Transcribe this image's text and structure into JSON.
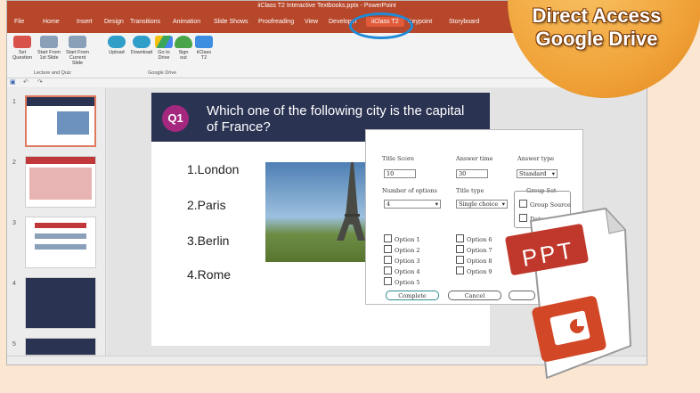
{
  "window": {
    "title": "iiClass T2 Interactive Textbooks.pptx - PowerPoint"
  },
  "tabs": [
    "File",
    "Home",
    "Insert",
    "Design",
    "Transitions",
    "Animation",
    "Slide Shows",
    "Proofreading",
    "View",
    "Developer",
    "iiClass T2",
    "Keypoint",
    "Storyboard"
  ],
  "ribbon": {
    "buttons": [
      {
        "label": "Set\nQuestion",
        "color": "#d8524b",
        "icon": "gear-icon"
      },
      {
        "label": "Start From\n1st Slide",
        "color": "#8aa0b9",
        "icon": "slide-icon"
      },
      {
        "label": "Start From\nCurrent Slide",
        "color": "#8aa0b9",
        "icon": "slide-icon"
      },
      {
        "label": "Upload",
        "color": "#2f9ec9",
        "icon": "cloud-upload-icon"
      },
      {
        "label": "Download",
        "color": "#2f9ec9",
        "icon": "cloud-download-icon"
      },
      {
        "label": "Go to\nDrive",
        "color": "#3ba55c",
        "icon": "drive-icon"
      },
      {
        "label": "Sign\nout",
        "color": "#4aa54a",
        "icon": "person-icon"
      },
      {
        "label": "iiClass\nT2",
        "color": "#3d8ee0",
        "icon": "iiclass-icon"
      }
    ],
    "group_lecture": "Lecture and Quiz",
    "group_drive": "Google Drive"
  },
  "thumbnails": [
    "1",
    "2",
    "3",
    "4",
    "5"
  ],
  "slide": {
    "badge": "Q1",
    "question": "Which one of the following city is the capital of France?",
    "options": [
      "1.London",
      "2.Paris",
      "3.Berlin",
      "4.Rome"
    ]
  },
  "dialog": {
    "title_score_label": "Title Score",
    "answer_time_label": "Answer time",
    "answer_type_label": "Answer type",
    "title_score_value": "10",
    "answer_time_value": "30",
    "answer_type_value": "Standard",
    "num_options_label": "Number of options",
    "title_type_label": "Title type",
    "group_set_label": "Group Set",
    "num_options_value": "4",
    "title_type_value": "Single choice",
    "group_source_label": "Group Source",
    "data_label": "Data",
    "options_left": [
      "Option 1",
      "Option 2",
      "Option 3",
      "Option 4",
      "Option 5"
    ],
    "options_right": [
      "Option 6",
      "Option 7",
      "Option 8",
      "Option 9"
    ],
    "complete_label": "Complete",
    "cancel_label": "Cancel"
  },
  "promo": {
    "line1": "Direct Access",
    "line2": "Google Drive",
    "ppt_label": "PPT"
  },
  "colors": {
    "accent": "#b7472a",
    "badge": "#f0a136",
    "highlight": "#1f8ad6"
  }
}
